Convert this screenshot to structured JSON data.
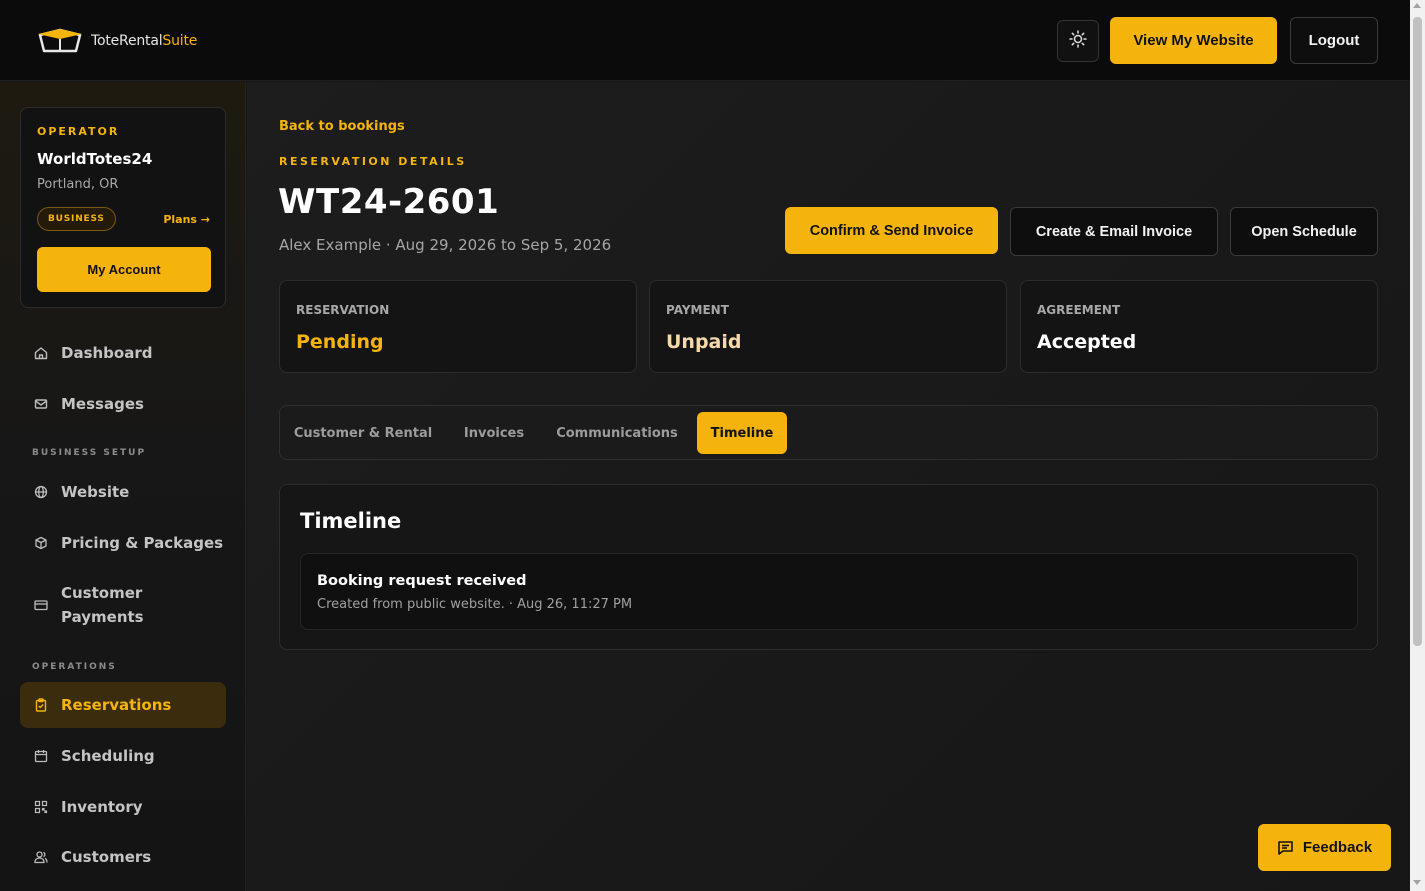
{
  "brand": {
    "name_part1": "ToteRental",
    "name_part2": "Suite",
    "accent_color": "#f5b40b",
    "logo_icon": "box-icon"
  },
  "header": {
    "theme_toggle_icon": "sun-icon",
    "view_website_label": "View My Website",
    "logout_label": "Logout"
  },
  "operator": {
    "label": "OPERATOR",
    "name": "WorldTotes24",
    "location": "Portland, OR",
    "plan_badge": "BUSINESS",
    "plans_link": "Plans →",
    "my_account_label": "My Account"
  },
  "sidebar": {
    "items": [
      {
        "label": "Dashboard",
        "icon": "home-icon"
      },
      {
        "label": "Messages",
        "icon": "mail-icon"
      },
      {
        "label": "Website",
        "icon": "globe-icon"
      },
      {
        "label": "Pricing & Packages",
        "icon": "package-icon"
      },
      {
        "label": "Customer Payments",
        "icon": "credit-card-icon"
      },
      {
        "label": "Reservations",
        "icon": "clipboard-icon",
        "active": true
      },
      {
        "label": "Scheduling",
        "icon": "calendar-icon"
      },
      {
        "label": "Inventory",
        "icon": "qr-code-icon"
      },
      {
        "label": "Customers",
        "icon": "users-icon"
      }
    ],
    "sections": {
      "business_setup": "BUSINESS SETUP",
      "operations": "OPERATIONS"
    }
  },
  "main": {
    "back_link": "Back to bookings",
    "eyebrow": "RESERVATION DETAILS",
    "reservation_id": "WT24-2601",
    "subtitle": "Alex Example · Aug 29, 2026 to Sep 5, 2026",
    "actions": {
      "confirm_send": "Confirm & Send Invoice",
      "create_email": "Create & Email Invoice",
      "open_schedule": "Open Schedule"
    },
    "status_cards": [
      {
        "label": "RESERVATION",
        "value": "Pending",
        "color": "#f5b40b"
      },
      {
        "label": "PAYMENT",
        "value": "Unpaid",
        "color": "#f5d9a8"
      },
      {
        "label": "AGREEMENT",
        "value": "Accepted",
        "color": "#ffffff"
      }
    ],
    "tabs": [
      {
        "label": "Customer & Rental"
      },
      {
        "label": "Invoices"
      },
      {
        "label": "Communications"
      },
      {
        "label": "Timeline",
        "active": true
      }
    ],
    "timeline": {
      "title": "Timeline",
      "events": [
        {
          "title": "Booking request received",
          "description": "Created from public website. · Aug 26, 11:27 PM"
        }
      ]
    }
  },
  "feedback": {
    "label": "Feedback",
    "icon": "message-square-icon"
  }
}
